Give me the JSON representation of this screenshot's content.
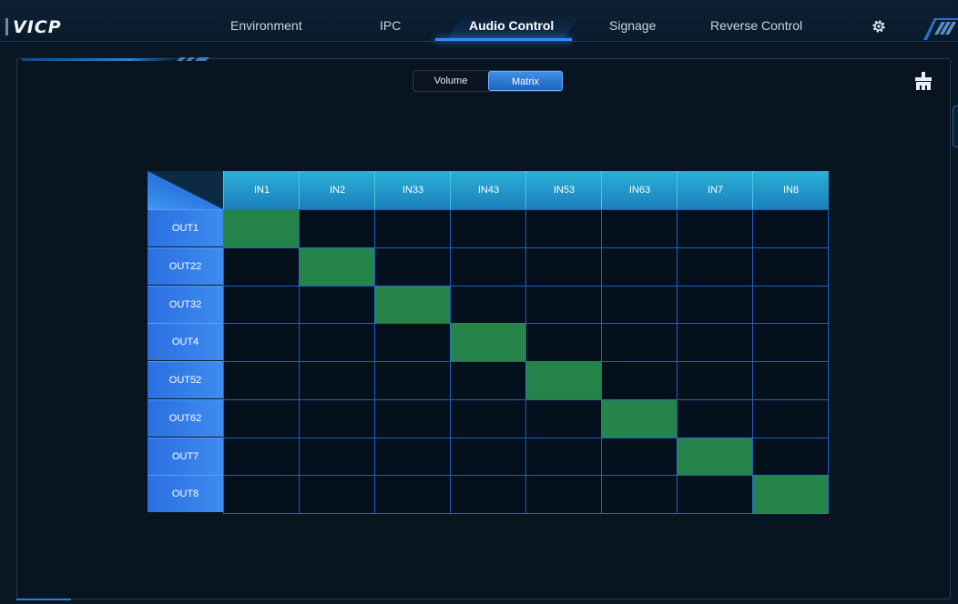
{
  "app": {
    "logo": "VICP"
  },
  "nav": {
    "items": [
      {
        "label": "Environment",
        "active": false
      },
      {
        "label": "IPC",
        "active": false
      },
      {
        "label": "Audio Control",
        "active": true
      },
      {
        "label": "Signage",
        "active": false
      },
      {
        "label": "Reverse Control",
        "active": false
      }
    ],
    "settings_icon": "gear-icon"
  },
  "toggle": {
    "volume_label": "Volume",
    "matrix_label": "Matrix",
    "selected": "Matrix"
  },
  "clean_icon": "broom-icon",
  "matrix": {
    "inputs": [
      "IN1",
      "IN2",
      "IN33",
      "IN43",
      "IN53",
      "IN63",
      "IN7",
      "IN8"
    ],
    "outputs": [
      "OUT1",
      "OUT22",
      "OUT32",
      "OUT4",
      "OUT52",
      "OUT62",
      "OUT7",
      "OUT8"
    ],
    "routes": [
      [
        1,
        0,
        0,
        0,
        0,
        0,
        0,
        0
      ],
      [
        0,
        1,
        0,
        0,
        0,
        0,
        0,
        0
      ],
      [
        0,
        0,
        1,
        0,
        0,
        0,
        0,
        0
      ],
      [
        0,
        0,
        0,
        1,
        0,
        0,
        0,
        0
      ],
      [
        0,
        0,
        0,
        0,
        1,
        0,
        0,
        0
      ],
      [
        0,
        0,
        0,
        0,
        0,
        1,
        0,
        0
      ],
      [
        0,
        0,
        0,
        0,
        0,
        0,
        1,
        0
      ],
      [
        0,
        0,
        0,
        0,
        0,
        0,
        0,
        1
      ]
    ]
  },
  "colors": {
    "route_on": "#24844a",
    "accent": "#2f8cff",
    "grid": "#1f5fc4"
  }
}
